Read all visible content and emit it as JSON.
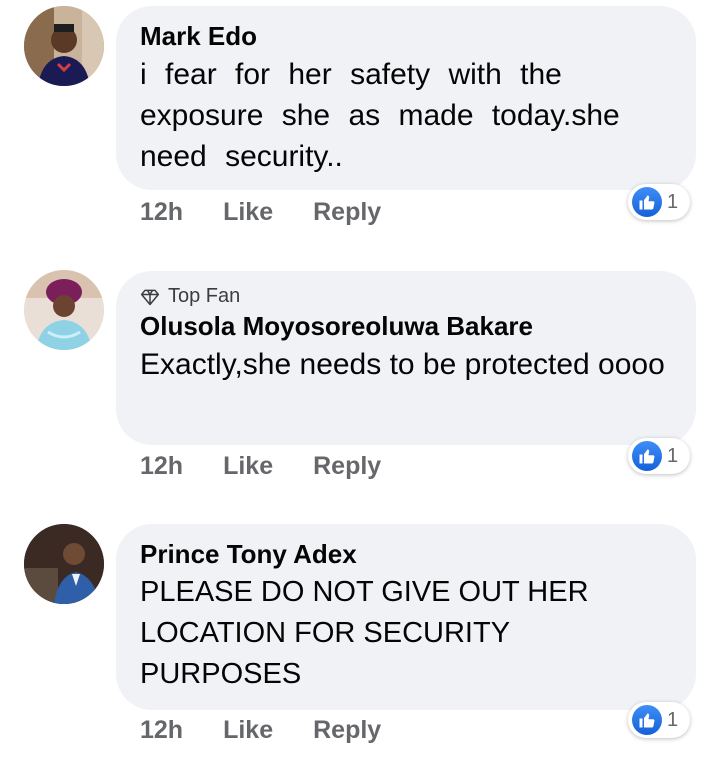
{
  "comments": [
    {
      "author": "Mark Edo",
      "badge": "",
      "text": "i fear for her safety with the exposure she as made today.she need security..",
      "time": "12h",
      "like_label": "Like",
      "reply_label": "Reply",
      "reaction_icon": "like-icon",
      "reaction_count": "1"
    },
    {
      "author": "Olusola Moyosoreoluwa Bakare",
      "badge": "Top Fan",
      "text": "Exactly,she needs to be protected oooo",
      "time": "12h",
      "like_label": "Like",
      "reply_label": "Reply",
      "reaction_icon": "like-icon",
      "reaction_count": "1"
    },
    {
      "author": "Prince Tony Adex",
      "badge": "",
      "text": "PLEASE DO NOT GIVE OUT HER LOCATION FOR SECURITY PURPOSES",
      "time": "12h",
      "like_label": "Like",
      "reply_label": "Reply",
      "reaction_icon": "like-icon",
      "reaction_count": "1"
    }
  ],
  "colors": {
    "bubble": "#f0f2f5",
    "meta_text": "#65676b",
    "like_blue": "#1877f2"
  }
}
